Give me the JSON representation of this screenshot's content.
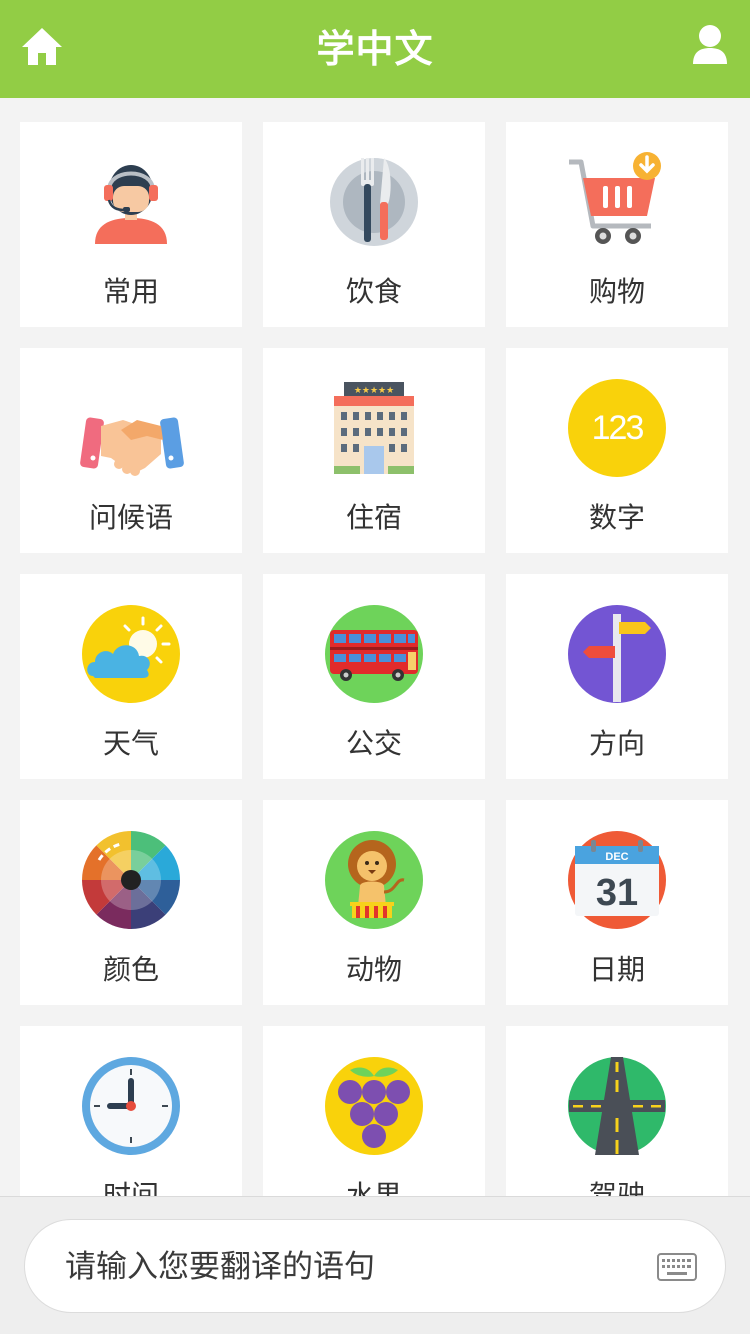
{
  "header": {
    "title": "学中文",
    "home_icon": "home-icon",
    "user_icon": "user-icon",
    "background": "#92cd45"
  },
  "categories": [
    {
      "label": "常用",
      "icon": "customer-service-icon"
    },
    {
      "label": "饮食",
      "icon": "dining-icon"
    },
    {
      "label": "购物",
      "icon": "shopping-cart-icon"
    },
    {
      "label": "问候语",
      "icon": "handshake-icon"
    },
    {
      "label": "住宿",
      "icon": "hotel-icon"
    },
    {
      "label": "数字",
      "icon": "numbers-icon",
      "icon_text": "123"
    },
    {
      "label": "天气",
      "icon": "weather-icon"
    },
    {
      "label": "公交",
      "icon": "bus-icon"
    },
    {
      "label": "方向",
      "icon": "signpost-icon"
    },
    {
      "label": "颜色",
      "icon": "color-wheel-icon"
    },
    {
      "label": "动物",
      "icon": "lion-icon"
    },
    {
      "label": "日期",
      "icon": "calendar-icon",
      "icon_month": "DEC",
      "icon_day": "31"
    },
    {
      "label": "时间",
      "icon": "clock-icon"
    },
    {
      "label": "水果",
      "icon": "grapes-icon"
    },
    {
      "label": "驾驶",
      "icon": "road-icon"
    }
  ],
  "search": {
    "placeholder": "请输入您要翻译的语句",
    "value": "",
    "keyboard_icon": "keyboard-icon"
  }
}
